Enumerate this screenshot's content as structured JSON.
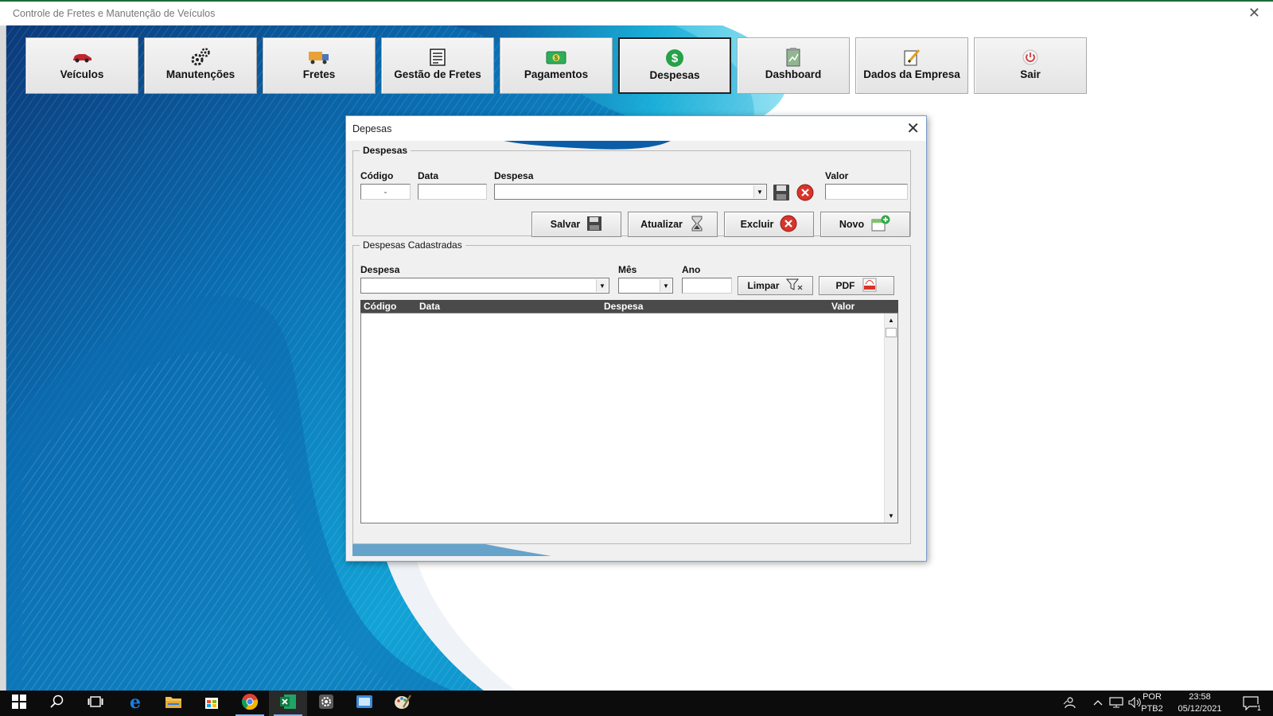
{
  "window": {
    "title": "Controle de Fretes e Manutenção de Veículos",
    "close_glyph": "✕"
  },
  "nav": [
    {
      "label": "Veículos",
      "icon": "car-icon"
    },
    {
      "label": "Manutenções",
      "icon": "gears-icon"
    },
    {
      "label": "Fretes",
      "icon": "truck-icon"
    },
    {
      "label": "Gestão de Fretes",
      "icon": "list-icon"
    },
    {
      "label": "Pagamentos",
      "icon": "money-icon"
    },
    {
      "label": "Despesas",
      "icon": "dollar-icon",
      "active": true
    },
    {
      "label": "Dashboard",
      "icon": "clipboard-icon"
    },
    {
      "label": "Dados da Empresa",
      "icon": "edit-icon"
    },
    {
      "label": "Sair",
      "icon": "power-icon"
    }
  ],
  "dialog": {
    "title": "Depesas",
    "close_glyph": "✕",
    "form": {
      "legend": "Despesas",
      "codigo_label": "Código",
      "codigo_value": "-",
      "data_label": "Data",
      "data_value": "",
      "despesa_label": "Despesa",
      "despesa_value": "",
      "valor_label": "Valor",
      "valor_value": "",
      "buttons": {
        "salvar": "Salvar",
        "atualizar": "Atualizar",
        "excluir": "Excluir",
        "novo": "Novo"
      }
    },
    "list": {
      "legend": "Despesas Cadastradas",
      "filter_despesa_label": "Despesa",
      "filter_mes_label": "Mês",
      "filter_ano_label": "Ano",
      "limpar_label": "Limpar",
      "pdf_label": "PDF",
      "columns": [
        "Código",
        "Data",
        "Despesa",
        "Valor"
      ],
      "rows": []
    }
  },
  "taskbar": {
    "language_top": "POR",
    "language_bottom": "PTB2",
    "time": "23:58",
    "date": "05/12/2021",
    "notification_count": "1"
  },
  "colors": {
    "accent_green": "#1e6b3a",
    "bg_blue": "#0a8fc6",
    "bg_dark": "#0b3a7a",
    "taskbar": "#0c0c0c"
  }
}
